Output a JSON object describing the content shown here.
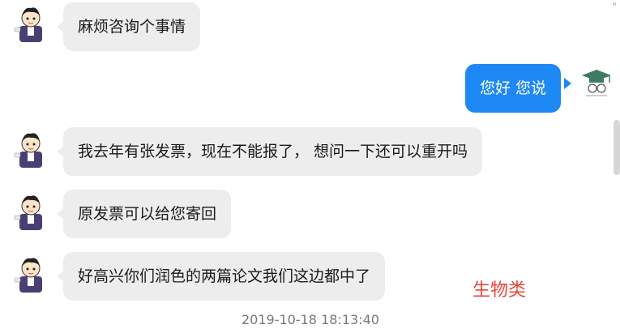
{
  "messages": [
    {
      "sender": "user",
      "text": "麻烦咨询个事情"
    },
    {
      "sender": "agent",
      "text": "您好 您说"
    },
    {
      "sender": "user",
      "text": "我去年有张发票，现在不能报了，  想问一下还可以重开吗"
    },
    {
      "sender": "user",
      "text": "原发票可以给您寄回"
    },
    {
      "sender": "user",
      "text": "好高兴你们润色的两篇论文我们这边都中了"
    }
  ],
  "annotation": "生物类",
  "timestamp": "2019-10-18 18:13:40",
  "colors": {
    "incoming_bubble": "#ededed",
    "outgoing_bubble": "#1e88f5",
    "annotation": "#e8463c",
    "timestamp": "#777777"
  },
  "icons": {
    "user_avatar": "cartoon-student-avatar-icon",
    "agent_avatar": "graduation-cap-logo-icon"
  }
}
